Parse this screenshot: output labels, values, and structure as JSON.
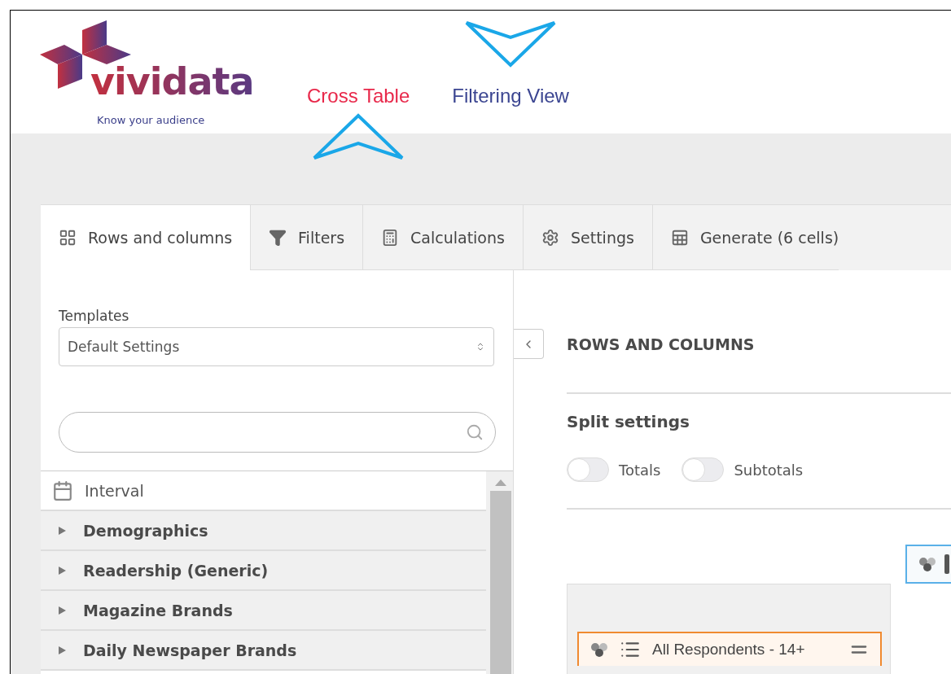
{
  "logo": {
    "wordmark": "vividata",
    "tagline": "Know your audience"
  },
  "nav": [
    {
      "label": "Cross Table",
      "selected": true,
      "kind": "below"
    },
    {
      "label": "Filtering View",
      "selected": false,
      "kind": "above"
    }
  ],
  "tabs": [
    {
      "label": "Rows and columns",
      "selected": true
    },
    {
      "label": "Filters",
      "selected": false
    },
    {
      "label": "Calculations",
      "selected": false
    },
    {
      "label": "Settings",
      "selected": false
    },
    {
      "label": "Generate (6 cells)",
      "selected": false
    }
  ],
  "templates": {
    "label": "Templates",
    "value": "Default Settings"
  },
  "tree": [
    {
      "label": "Interval",
      "kind": "item"
    },
    {
      "label": "Demographics",
      "kind": "group",
      "expanded": false
    },
    {
      "label": "Readership (Generic)",
      "kind": "group",
      "expanded": false
    },
    {
      "label": "Magazine Brands",
      "kind": "group",
      "expanded": false
    },
    {
      "label": "Daily Newspaper Brands",
      "kind": "group",
      "expanded": false
    }
  ],
  "main": {
    "heading": "ROWS AND COLUMNS",
    "split_title": "Split settings",
    "toggles": [
      {
        "label": "Totals",
        "on": false
      },
      {
        "label": "Subtotals",
        "on": false
      }
    ],
    "rows": [
      {
        "label": "All Respondents - 14+"
      }
    ]
  }
}
